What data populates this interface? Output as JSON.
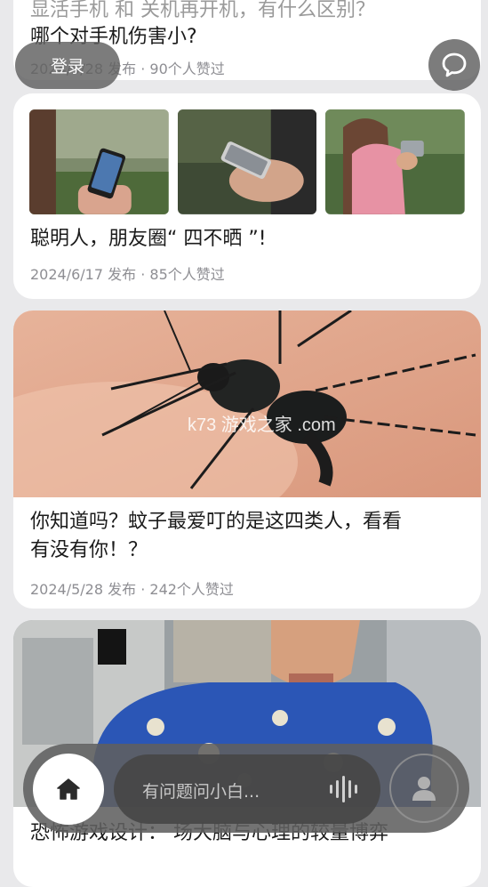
{
  "header": {
    "login_label": "登录"
  },
  "articles": [
    {
      "title_line1": "显活手机 和 关机再开机，有什么区别？",
      "title_line2": "哪个对手机伤害小?",
      "meta": "2024/5/28 发布 · 90个人赞过"
    },
    {
      "title": "聪明人，朋友圈“ 四不晒 ”!",
      "meta": "2024/6/17 发布 · 85个人赞过"
    },
    {
      "title_line1": "你知道吗？蚊子最爱叮的是这四类人，看看",
      "title_line2": "有没有你！？",
      "meta": "2024/5/28 发布 · 242个人赞过",
      "watermark": "k73 游戏之家 .com"
    },
    {
      "title": "恐怖游戏设计：    场大脑与心理的较量博弈"
    }
  ],
  "bottom_bar": {
    "ask_placeholder": "有问题问小白..."
  },
  "colors": {
    "background": "#e9e9eb",
    "card": "#ffffff",
    "overlay": "#5f5f5f",
    "meta_text": "#8e8e93"
  },
  "icons": [
    "chat-bubble-icon",
    "home-icon",
    "voice-wave-icon",
    "user-icon"
  ]
}
